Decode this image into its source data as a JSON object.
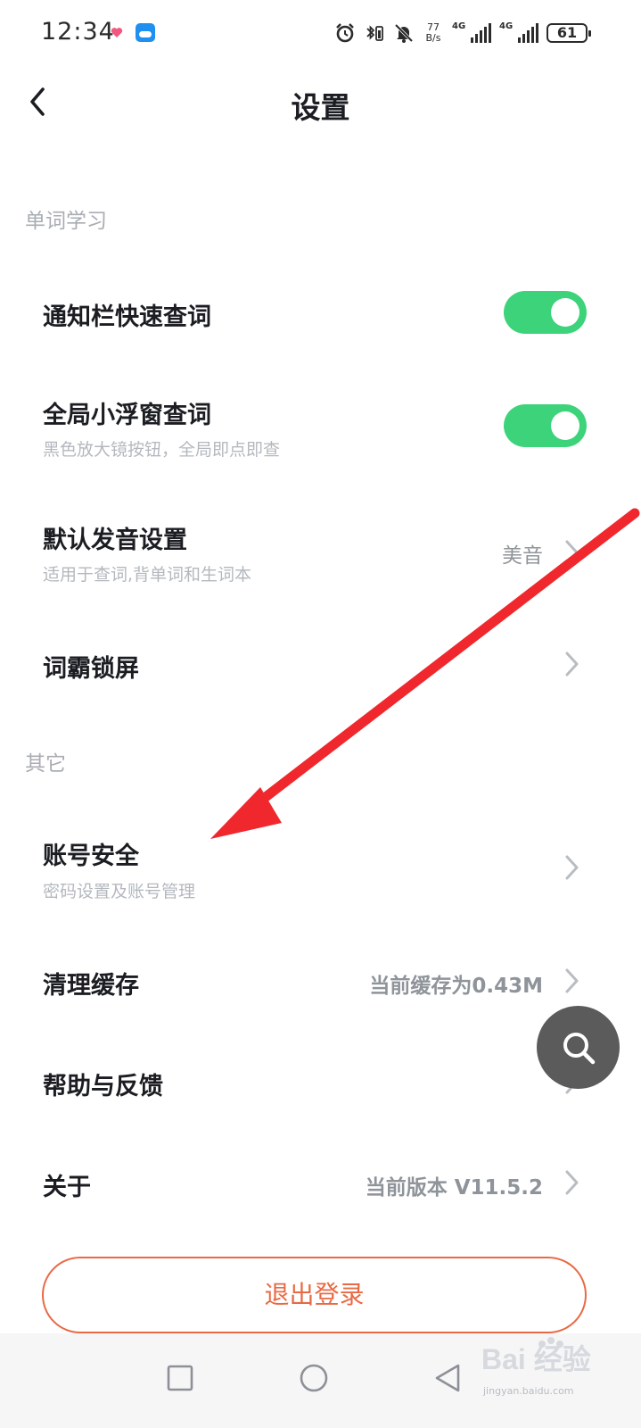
{
  "status_bar": {
    "time": "12:34",
    "net_speed_value": "77",
    "net_speed_unit": "B/s",
    "signal1_label": "4G",
    "signal2_label": "4G",
    "battery": "61"
  },
  "header": {
    "title": "设置"
  },
  "sections": {
    "word_learning": "单词学习",
    "other": "其它"
  },
  "rows": {
    "notification_lookup": {
      "title": "通知栏快速查词",
      "enabled": true
    },
    "float_window_lookup": {
      "title": "全局小浮窗查词",
      "subtitle": "黑色放大镜按钮，全局即点即查",
      "enabled": true
    },
    "default_pronunciation": {
      "title": "默认发音设置",
      "subtitle": "适用于查词,背单词和生词本",
      "value": "美音"
    },
    "lock_screen": {
      "title": "词霸锁屏"
    },
    "account_security": {
      "title": "账号安全",
      "subtitle": "密码设置及账号管理"
    },
    "clear_cache": {
      "title": "清理缓存",
      "value": "当前缓存为0.43M"
    },
    "help_feedback": {
      "title": "帮助与反馈"
    },
    "about": {
      "title": "关于",
      "value": "当前版本 V11.5.2"
    }
  },
  "logout": {
    "label": "退出登录"
  },
  "watermark": {
    "text": "Bai 经验",
    "sub": "jingyan.baidu.com"
  },
  "colors": {
    "toggle_on": "#3dd37a",
    "logout_accent": "#e86a45",
    "annotation_arrow": "#f0282d"
  },
  "icons": {
    "back": "chevron-left-icon",
    "row_more": "chevron-right-icon",
    "fab": "search-icon"
  }
}
